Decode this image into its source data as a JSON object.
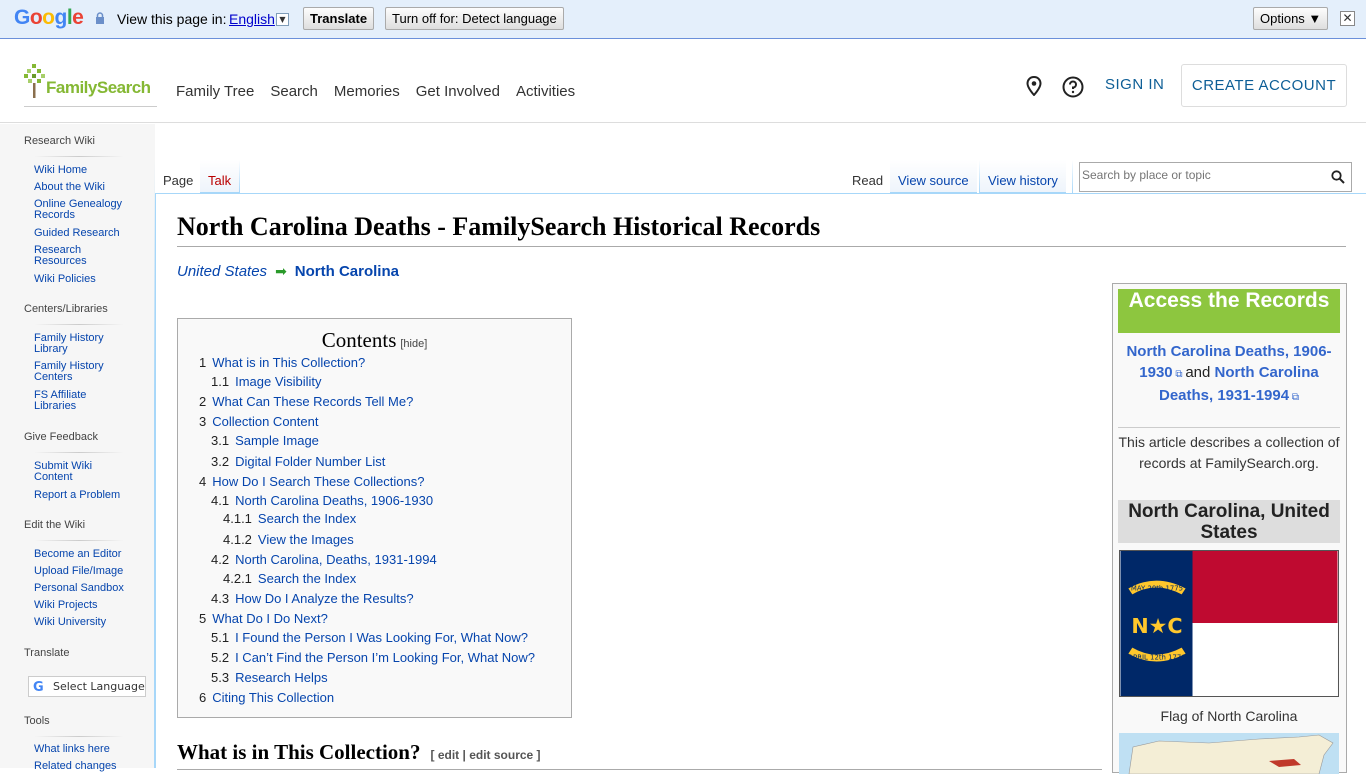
{
  "google_bar": {
    "logo": "Google",
    "view_text": "View this page in:",
    "language": "English",
    "translate_button": "Translate",
    "turn_off_button": "Turn off for: Detect language",
    "options_button": "Options ▼",
    "close": "✕"
  },
  "header": {
    "logo_text": "FamilySearch",
    "nav": [
      "Family Tree",
      "Search",
      "Memories",
      "Get Involved",
      "Activities"
    ],
    "sign_in": "SIGN IN",
    "create_account": "CREATE ACCOUNT"
  },
  "sidebar": {
    "research_wiki": "Research Wiki",
    "research_items": [
      "Wiki Home",
      "About the Wiki",
      "Online Genealogy Records",
      "Guided Research",
      "Research Resources",
      "Wiki Policies"
    ],
    "centers_head": "Centers/Libraries",
    "centers_items": [
      "Family History Library",
      "Family History Centers",
      "FS Affiliate Libraries"
    ],
    "feedback_head": "Give Feedback",
    "feedback_items": [
      "Submit Wiki Content",
      "Report a Problem"
    ],
    "edit_head": "Edit the Wiki",
    "edit_items": [
      "Become an Editor",
      "Upload File/Image",
      "Personal Sandbox",
      "Wiki Projects",
      "Wiki University"
    ],
    "translate_head": "Translate",
    "select_language": "Select Language",
    "tools_head": "Tools",
    "tools_items": [
      "What links here",
      "Related changes"
    ]
  },
  "tabs": {
    "page": "Page",
    "talk": "Talk",
    "read": "Read",
    "view_source": "View source",
    "view_history": "View history"
  },
  "search": {
    "placeholder": "Search by place or topic"
  },
  "article": {
    "title": "North Carolina Deaths - FamilySearch Historical Records",
    "breadcrumb_parent": "United States",
    "breadcrumb_current": "North Carolina",
    "toc_title": "Contents",
    "toc_hide": "[hide]",
    "toc": [
      {
        "num": "1",
        "label": "What is in This Collection?"
      },
      {
        "num": "1.1",
        "label": "Image Visibility"
      },
      {
        "num": "2",
        "label": "What Can These Records Tell Me?"
      },
      {
        "num": "3",
        "label": "Collection Content"
      },
      {
        "num": "3.1",
        "label": "Sample Image"
      },
      {
        "num": "3.2",
        "label": "Digital Folder Number List"
      },
      {
        "num": "4",
        "label": "How Do I Search These Collections?"
      },
      {
        "num": "4.1",
        "label": "North Carolina Deaths, 1906-1930"
      },
      {
        "num": "4.1.1",
        "label": "Search the Index"
      },
      {
        "num": "4.1.2",
        "label": "View the Images"
      },
      {
        "num": "4.2",
        "label": "North Carolina, Deaths, 1931-1994"
      },
      {
        "num": "4.2.1",
        "label": "Search the Index"
      },
      {
        "num": "4.3",
        "label": "How Do I Analyze the Results?"
      },
      {
        "num": "5",
        "label": "What Do I Do Next?"
      },
      {
        "num": "5.1",
        "label": "I Found the Person I Was Looking For, What Now?"
      },
      {
        "num": "5.2",
        "label": "I Can’t Find the Person I’m Looking For, What Now?"
      },
      {
        "num": "5.3",
        "label": "Research Helps"
      },
      {
        "num": "6",
        "label": "Citing This Collection"
      }
    ],
    "section_heading": "What is in This Collection?",
    "section_edit": "[ edit | edit source ]"
  },
  "infobox": {
    "access_title": "Access the Records",
    "link1": "North Carolina Deaths, 1906-1930",
    "and": "and",
    "link2": "North Carolina Deaths, 1931-1994",
    "description": "This article describes a collection of records at FamilySearch.org.",
    "state_title": "North Carolina, United States",
    "flag_caption": "Flag of North Carolina",
    "flag_date_top": "MAY 20th 1775",
    "flag_date_bottom": "APRIL 12th 1776",
    "flag_letters": "N★C"
  },
  "colors": {
    "link": "#0645ad",
    "accent_green": "#8dc63f",
    "fs_blue": "#0d5e96",
    "flag_blue": "#002868",
    "flag_red": "#bf0a30",
    "flag_gold": "#ffc72c"
  }
}
